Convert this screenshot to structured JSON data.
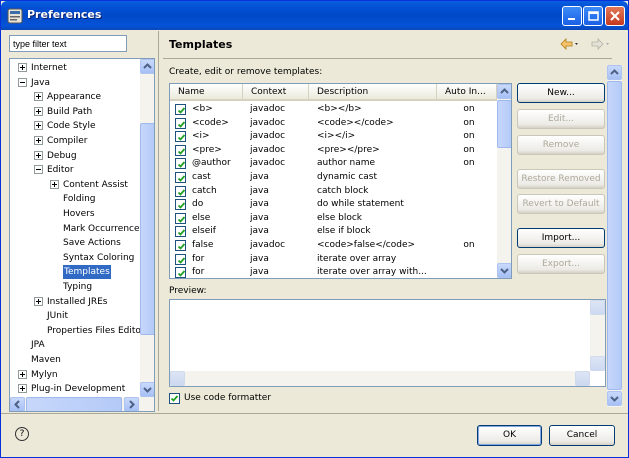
{
  "window": {
    "title": "Preferences"
  },
  "filter": {
    "placeholder": "type filter text"
  },
  "tree": [
    {
      "label": "Internet",
      "indent": 0,
      "expander": "plus"
    },
    {
      "label": "Java",
      "indent": 0,
      "expander": "minus"
    },
    {
      "label": "Appearance",
      "indent": 1,
      "expander": "plus"
    },
    {
      "label": "Build Path",
      "indent": 1,
      "expander": "plus"
    },
    {
      "label": "Code Style",
      "indent": 1,
      "expander": "plus"
    },
    {
      "label": "Compiler",
      "indent": 1,
      "expander": "plus"
    },
    {
      "label": "Debug",
      "indent": 1,
      "expander": "plus"
    },
    {
      "label": "Editor",
      "indent": 1,
      "expander": "minus"
    },
    {
      "label": "Content Assist",
      "indent": 2,
      "expander": "plus"
    },
    {
      "label": "Folding",
      "indent": 2,
      "expander": "none"
    },
    {
      "label": "Hovers",
      "indent": 2,
      "expander": "none"
    },
    {
      "label": "Mark Occurrences",
      "indent": 2,
      "expander": "none"
    },
    {
      "label": "Save Actions",
      "indent": 2,
      "expander": "none"
    },
    {
      "label": "Syntax Coloring",
      "indent": 2,
      "expander": "none"
    },
    {
      "label": "Templates",
      "indent": 2,
      "expander": "none",
      "selected": true
    },
    {
      "label": "Typing",
      "indent": 2,
      "expander": "none"
    },
    {
      "label": "Installed JREs",
      "indent": 1,
      "expander": "plus"
    },
    {
      "label": "JUnit",
      "indent": 1,
      "expander": "none"
    },
    {
      "label": "Properties Files Editor",
      "indent": 1,
      "expander": "none"
    },
    {
      "label": "JPA",
      "indent": 0,
      "expander": "none"
    },
    {
      "label": "Maven",
      "indent": 0,
      "expander": "none"
    },
    {
      "label": "Mylyn",
      "indent": 0,
      "expander": "plus"
    },
    {
      "label": "Plug-in Development",
      "indent": 0,
      "expander": "plus"
    }
  ],
  "page": {
    "title": "Templates",
    "description": "Create, edit or remove templates:",
    "preview_label": "Preview:",
    "use_code_formatter_label": "Use code formatter",
    "use_code_formatter_checked": true
  },
  "table": {
    "columns": [
      "Name",
      "Context",
      "Description",
      "Auto In..."
    ],
    "rows": [
      {
        "name": "<b>",
        "context": "javadoc",
        "description": "<b></b>",
        "auto": "on",
        "checked": true
      },
      {
        "name": "<code>",
        "context": "javadoc",
        "description": "<code></code>",
        "auto": "on",
        "checked": true
      },
      {
        "name": "<i>",
        "context": "javadoc",
        "description": "<i></i>",
        "auto": "on",
        "checked": true
      },
      {
        "name": "<pre>",
        "context": "javadoc",
        "description": "<pre></pre>",
        "auto": "on",
        "checked": true
      },
      {
        "name": "@author",
        "context": "javadoc",
        "description": "author name",
        "auto": "on",
        "checked": true
      },
      {
        "name": "cast",
        "context": "java",
        "description": "dynamic cast",
        "auto": "",
        "checked": true
      },
      {
        "name": "catch",
        "context": "java",
        "description": "catch block",
        "auto": "",
        "checked": true
      },
      {
        "name": "do",
        "context": "java",
        "description": "do while statement",
        "auto": "",
        "checked": true
      },
      {
        "name": "else",
        "context": "java",
        "description": "else block",
        "auto": "",
        "checked": true
      },
      {
        "name": "elseif",
        "context": "java",
        "description": "else if block",
        "auto": "",
        "checked": true
      },
      {
        "name": "false",
        "context": "javadoc",
        "description": "<code>false</code>",
        "auto": "on",
        "checked": true
      },
      {
        "name": "for",
        "context": "java",
        "description": "iterate over array",
        "auto": "",
        "checked": true
      },
      {
        "name": "for",
        "context": "java",
        "description": "iterate over array with...",
        "auto": "",
        "checked": true
      }
    ]
  },
  "buttons": {
    "new": "New...",
    "edit": "Edit...",
    "remove": "Remove",
    "restore_removed": "Restore Removed",
    "revert_default": "Revert to Default",
    "import": "Import...",
    "export": "Export...",
    "ok": "OK",
    "cancel": "Cancel"
  },
  "colors": {
    "selection": "#316ac5",
    "titlebar": "#0451d6",
    "border": "#7f9db9"
  }
}
